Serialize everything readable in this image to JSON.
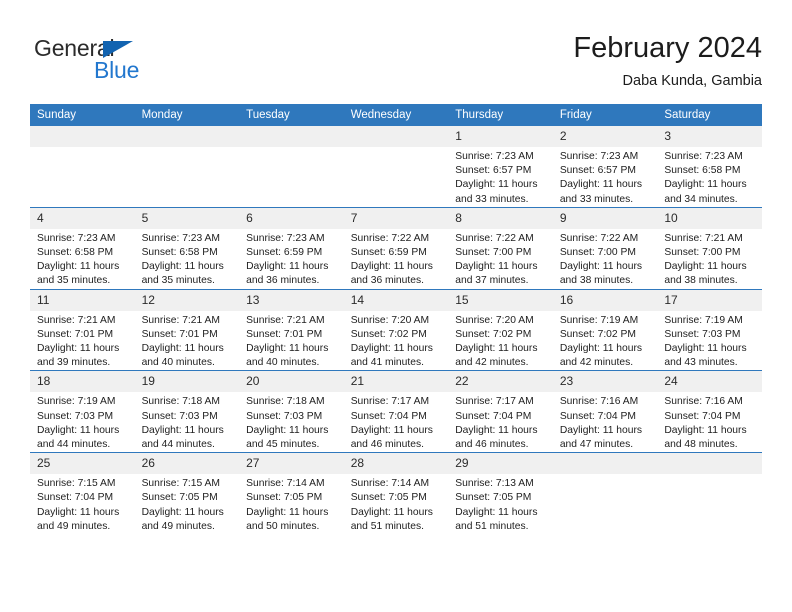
{
  "brand": {
    "name_part1": "General",
    "name_part2": "Blue",
    "accent_color": "#2277ce",
    "triangle_color": "#1263b0"
  },
  "header": {
    "title": "February 2024",
    "subtitle": "Daba Kunda, Gambia"
  },
  "calendar": {
    "header_color": "#2f78bd",
    "daynum_band_color": "#f0f0f0",
    "weekdays": [
      "Sunday",
      "Monday",
      "Tuesday",
      "Wednesday",
      "Thursday",
      "Friday",
      "Saturday"
    ],
    "weeks": [
      [
        {
          "day": "",
          "empty": true
        },
        {
          "day": "",
          "empty": true
        },
        {
          "day": "",
          "empty": true
        },
        {
          "day": "",
          "empty": true
        },
        {
          "day": "1",
          "sunrise": "Sunrise: 7:23 AM",
          "sunset": "Sunset: 6:57 PM",
          "daylight_1": "Daylight: 11 hours",
          "daylight_2": "and 33 minutes."
        },
        {
          "day": "2",
          "sunrise": "Sunrise: 7:23 AM",
          "sunset": "Sunset: 6:57 PM",
          "daylight_1": "Daylight: 11 hours",
          "daylight_2": "and 33 minutes."
        },
        {
          "day": "3",
          "sunrise": "Sunrise: 7:23 AM",
          "sunset": "Sunset: 6:58 PM",
          "daylight_1": "Daylight: 11 hours",
          "daylight_2": "and 34 minutes."
        }
      ],
      [
        {
          "day": "4",
          "sunrise": "Sunrise: 7:23 AM",
          "sunset": "Sunset: 6:58 PM",
          "daylight_1": "Daylight: 11 hours",
          "daylight_2": "and 35 minutes."
        },
        {
          "day": "5",
          "sunrise": "Sunrise: 7:23 AM",
          "sunset": "Sunset: 6:58 PM",
          "daylight_1": "Daylight: 11 hours",
          "daylight_2": "and 35 minutes."
        },
        {
          "day": "6",
          "sunrise": "Sunrise: 7:23 AM",
          "sunset": "Sunset: 6:59 PM",
          "daylight_1": "Daylight: 11 hours",
          "daylight_2": "and 36 minutes."
        },
        {
          "day": "7",
          "sunrise": "Sunrise: 7:22 AM",
          "sunset": "Sunset: 6:59 PM",
          "daylight_1": "Daylight: 11 hours",
          "daylight_2": "and 36 minutes."
        },
        {
          "day": "8",
          "sunrise": "Sunrise: 7:22 AM",
          "sunset": "Sunset: 7:00 PM",
          "daylight_1": "Daylight: 11 hours",
          "daylight_2": "and 37 minutes."
        },
        {
          "day": "9",
          "sunrise": "Sunrise: 7:22 AM",
          "sunset": "Sunset: 7:00 PM",
          "daylight_1": "Daylight: 11 hours",
          "daylight_2": "and 38 minutes."
        },
        {
          "day": "10",
          "sunrise": "Sunrise: 7:21 AM",
          "sunset": "Sunset: 7:00 PM",
          "daylight_1": "Daylight: 11 hours",
          "daylight_2": "and 38 minutes."
        }
      ],
      [
        {
          "day": "11",
          "sunrise": "Sunrise: 7:21 AM",
          "sunset": "Sunset: 7:01 PM",
          "daylight_1": "Daylight: 11 hours",
          "daylight_2": "and 39 minutes."
        },
        {
          "day": "12",
          "sunrise": "Sunrise: 7:21 AM",
          "sunset": "Sunset: 7:01 PM",
          "daylight_1": "Daylight: 11 hours",
          "daylight_2": "and 40 minutes."
        },
        {
          "day": "13",
          "sunrise": "Sunrise: 7:21 AM",
          "sunset": "Sunset: 7:01 PM",
          "daylight_1": "Daylight: 11 hours",
          "daylight_2": "and 40 minutes."
        },
        {
          "day": "14",
          "sunrise": "Sunrise: 7:20 AM",
          "sunset": "Sunset: 7:02 PM",
          "daylight_1": "Daylight: 11 hours",
          "daylight_2": "and 41 minutes."
        },
        {
          "day": "15",
          "sunrise": "Sunrise: 7:20 AM",
          "sunset": "Sunset: 7:02 PM",
          "daylight_1": "Daylight: 11 hours",
          "daylight_2": "and 42 minutes."
        },
        {
          "day": "16",
          "sunrise": "Sunrise: 7:19 AM",
          "sunset": "Sunset: 7:02 PM",
          "daylight_1": "Daylight: 11 hours",
          "daylight_2": "and 42 minutes."
        },
        {
          "day": "17",
          "sunrise": "Sunrise: 7:19 AM",
          "sunset": "Sunset: 7:03 PM",
          "daylight_1": "Daylight: 11 hours",
          "daylight_2": "and 43 minutes."
        }
      ],
      [
        {
          "day": "18",
          "sunrise": "Sunrise: 7:19 AM",
          "sunset": "Sunset: 7:03 PM",
          "daylight_1": "Daylight: 11 hours",
          "daylight_2": "and 44 minutes."
        },
        {
          "day": "19",
          "sunrise": "Sunrise: 7:18 AM",
          "sunset": "Sunset: 7:03 PM",
          "daylight_1": "Daylight: 11 hours",
          "daylight_2": "and 44 minutes."
        },
        {
          "day": "20",
          "sunrise": "Sunrise: 7:18 AM",
          "sunset": "Sunset: 7:03 PM",
          "daylight_1": "Daylight: 11 hours",
          "daylight_2": "and 45 minutes."
        },
        {
          "day": "21",
          "sunrise": "Sunrise: 7:17 AM",
          "sunset": "Sunset: 7:04 PM",
          "daylight_1": "Daylight: 11 hours",
          "daylight_2": "and 46 minutes."
        },
        {
          "day": "22",
          "sunrise": "Sunrise: 7:17 AM",
          "sunset": "Sunset: 7:04 PM",
          "daylight_1": "Daylight: 11 hours",
          "daylight_2": "and 46 minutes."
        },
        {
          "day": "23",
          "sunrise": "Sunrise: 7:16 AM",
          "sunset": "Sunset: 7:04 PM",
          "daylight_1": "Daylight: 11 hours",
          "daylight_2": "and 47 minutes."
        },
        {
          "day": "24",
          "sunrise": "Sunrise: 7:16 AM",
          "sunset": "Sunset: 7:04 PM",
          "daylight_1": "Daylight: 11 hours",
          "daylight_2": "and 48 minutes."
        }
      ],
      [
        {
          "day": "25",
          "sunrise": "Sunrise: 7:15 AM",
          "sunset": "Sunset: 7:04 PM",
          "daylight_1": "Daylight: 11 hours",
          "daylight_2": "and 49 minutes."
        },
        {
          "day": "26",
          "sunrise": "Sunrise: 7:15 AM",
          "sunset": "Sunset: 7:05 PM",
          "daylight_1": "Daylight: 11 hours",
          "daylight_2": "and 49 minutes."
        },
        {
          "day": "27",
          "sunrise": "Sunrise: 7:14 AM",
          "sunset": "Sunset: 7:05 PM",
          "daylight_1": "Daylight: 11 hours",
          "daylight_2": "and 50 minutes."
        },
        {
          "day": "28",
          "sunrise": "Sunrise: 7:14 AM",
          "sunset": "Sunset: 7:05 PM",
          "daylight_1": "Daylight: 11 hours",
          "daylight_2": "and 51 minutes."
        },
        {
          "day": "29",
          "sunrise": "Sunrise: 7:13 AM",
          "sunset": "Sunset: 7:05 PM",
          "daylight_1": "Daylight: 11 hours",
          "daylight_2": "and 51 minutes."
        },
        {
          "day": "",
          "empty": true
        },
        {
          "day": "",
          "empty": true
        }
      ]
    ]
  }
}
